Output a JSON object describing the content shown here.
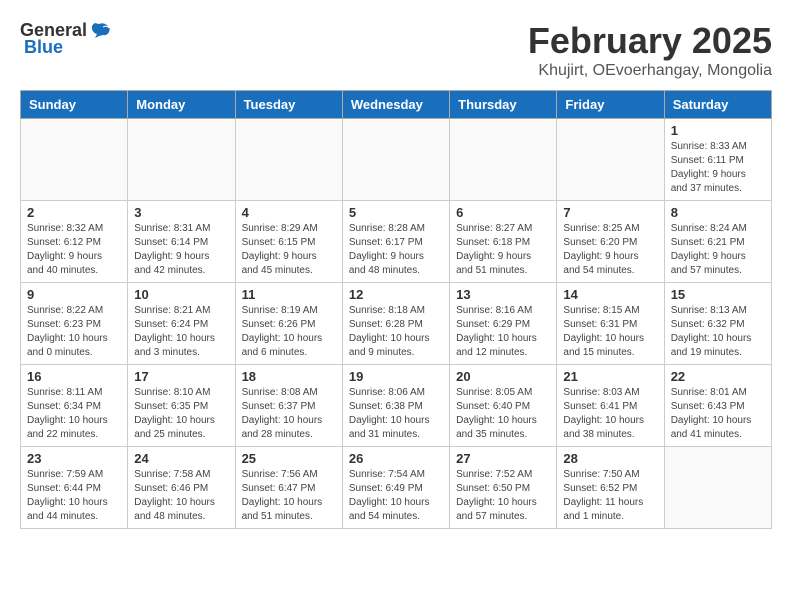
{
  "logo": {
    "general": "General",
    "blue": "Blue"
  },
  "header": {
    "title": "February 2025",
    "subtitle": "Khujirt, OEvoerhangay, Mongolia"
  },
  "weekdays": [
    "Sunday",
    "Monday",
    "Tuesday",
    "Wednesday",
    "Thursday",
    "Friday",
    "Saturday"
  ],
  "weeks": [
    [
      {
        "day": null
      },
      {
        "day": null
      },
      {
        "day": null
      },
      {
        "day": null
      },
      {
        "day": null
      },
      {
        "day": null
      },
      {
        "day": "1",
        "sunrise": "Sunrise: 8:33 AM",
        "sunset": "Sunset: 6:11 PM",
        "daylight": "Daylight: 9 hours and 37 minutes."
      }
    ],
    [
      {
        "day": "2",
        "sunrise": "Sunrise: 8:32 AM",
        "sunset": "Sunset: 6:12 PM",
        "daylight": "Daylight: 9 hours and 40 minutes."
      },
      {
        "day": "3",
        "sunrise": "Sunrise: 8:31 AM",
        "sunset": "Sunset: 6:14 PM",
        "daylight": "Daylight: 9 hours and 42 minutes."
      },
      {
        "day": "4",
        "sunrise": "Sunrise: 8:29 AM",
        "sunset": "Sunset: 6:15 PM",
        "daylight": "Daylight: 9 hours and 45 minutes."
      },
      {
        "day": "5",
        "sunrise": "Sunrise: 8:28 AM",
        "sunset": "Sunset: 6:17 PM",
        "daylight": "Daylight: 9 hours and 48 minutes."
      },
      {
        "day": "6",
        "sunrise": "Sunrise: 8:27 AM",
        "sunset": "Sunset: 6:18 PM",
        "daylight": "Daylight: 9 hours and 51 minutes."
      },
      {
        "day": "7",
        "sunrise": "Sunrise: 8:25 AM",
        "sunset": "Sunset: 6:20 PM",
        "daylight": "Daylight: 9 hours and 54 minutes."
      },
      {
        "day": "8",
        "sunrise": "Sunrise: 8:24 AM",
        "sunset": "Sunset: 6:21 PM",
        "daylight": "Daylight: 9 hours and 57 minutes."
      }
    ],
    [
      {
        "day": "9",
        "sunrise": "Sunrise: 8:22 AM",
        "sunset": "Sunset: 6:23 PM",
        "daylight": "Daylight: 10 hours and 0 minutes."
      },
      {
        "day": "10",
        "sunrise": "Sunrise: 8:21 AM",
        "sunset": "Sunset: 6:24 PM",
        "daylight": "Daylight: 10 hours and 3 minutes."
      },
      {
        "day": "11",
        "sunrise": "Sunrise: 8:19 AM",
        "sunset": "Sunset: 6:26 PM",
        "daylight": "Daylight: 10 hours and 6 minutes."
      },
      {
        "day": "12",
        "sunrise": "Sunrise: 8:18 AM",
        "sunset": "Sunset: 6:28 PM",
        "daylight": "Daylight: 10 hours and 9 minutes."
      },
      {
        "day": "13",
        "sunrise": "Sunrise: 8:16 AM",
        "sunset": "Sunset: 6:29 PM",
        "daylight": "Daylight: 10 hours and 12 minutes."
      },
      {
        "day": "14",
        "sunrise": "Sunrise: 8:15 AM",
        "sunset": "Sunset: 6:31 PM",
        "daylight": "Daylight: 10 hours and 15 minutes."
      },
      {
        "day": "15",
        "sunrise": "Sunrise: 8:13 AM",
        "sunset": "Sunset: 6:32 PM",
        "daylight": "Daylight: 10 hours and 19 minutes."
      }
    ],
    [
      {
        "day": "16",
        "sunrise": "Sunrise: 8:11 AM",
        "sunset": "Sunset: 6:34 PM",
        "daylight": "Daylight: 10 hours and 22 minutes."
      },
      {
        "day": "17",
        "sunrise": "Sunrise: 8:10 AM",
        "sunset": "Sunset: 6:35 PM",
        "daylight": "Daylight: 10 hours and 25 minutes."
      },
      {
        "day": "18",
        "sunrise": "Sunrise: 8:08 AM",
        "sunset": "Sunset: 6:37 PM",
        "daylight": "Daylight: 10 hours and 28 minutes."
      },
      {
        "day": "19",
        "sunrise": "Sunrise: 8:06 AM",
        "sunset": "Sunset: 6:38 PM",
        "daylight": "Daylight: 10 hours and 31 minutes."
      },
      {
        "day": "20",
        "sunrise": "Sunrise: 8:05 AM",
        "sunset": "Sunset: 6:40 PM",
        "daylight": "Daylight: 10 hours and 35 minutes."
      },
      {
        "day": "21",
        "sunrise": "Sunrise: 8:03 AM",
        "sunset": "Sunset: 6:41 PM",
        "daylight": "Daylight: 10 hours and 38 minutes."
      },
      {
        "day": "22",
        "sunrise": "Sunrise: 8:01 AM",
        "sunset": "Sunset: 6:43 PM",
        "daylight": "Daylight: 10 hours and 41 minutes."
      }
    ],
    [
      {
        "day": "23",
        "sunrise": "Sunrise: 7:59 AM",
        "sunset": "Sunset: 6:44 PM",
        "daylight": "Daylight: 10 hours and 44 minutes."
      },
      {
        "day": "24",
        "sunrise": "Sunrise: 7:58 AM",
        "sunset": "Sunset: 6:46 PM",
        "daylight": "Daylight: 10 hours and 48 minutes."
      },
      {
        "day": "25",
        "sunrise": "Sunrise: 7:56 AM",
        "sunset": "Sunset: 6:47 PM",
        "daylight": "Daylight: 10 hours and 51 minutes."
      },
      {
        "day": "26",
        "sunrise": "Sunrise: 7:54 AM",
        "sunset": "Sunset: 6:49 PM",
        "daylight": "Daylight: 10 hours and 54 minutes."
      },
      {
        "day": "27",
        "sunrise": "Sunrise: 7:52 AM",
        "sunset": "Sunset: 6:50 PM",
        "daylight": "Daylight: 10 hours and 57 minutes."
      },
      {
        "day": "28",
        "sunrise": "Sunrise: 7:50 AM",
        "sunset": "Sunset: 6:52 PM",
        "daylight": "Daylight: 11 hours and 1 minute."
      },
      {
        "day": null
      }
    ]
  ]
}
